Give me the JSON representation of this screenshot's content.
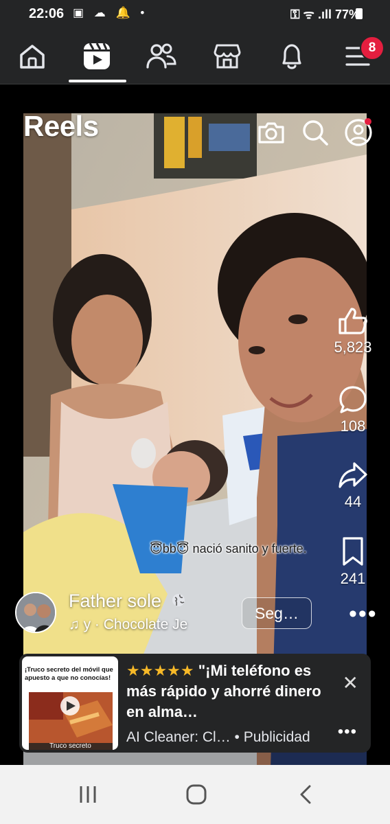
{
  "status_bar": {
    "time": "22:06",
    "left_icons": "▣ ☁ 🔔 •",
    "right_text": "⚿ ᯤ .ıll 77%"
  },
  "nav": {
    "items": [
      {
        "name": "home",
        "icon": "home-icon"
      },
      {
        "name": "reels",
        "icon": "reels-icon",
        "active": true
      },
      {
        "name": "friends",
        "icon": "friends-icon"
      },
      {
        "name": "marketplace",
        "icon": "marketplace-icon"
      },
      {
        "name": "notifications",
        "icon": "bell-icon"
      },
      {
        "name": "menu",
        "icon": "menu-icon"
      }
    ],
    "menu_badge": "8"
  },
  "reels": {
    "title": "Reels",
    "likes": "5,823",
    "comments": "108",
    "shares": "44",
    "saves": "241",
    "caption": "😇bb😇 nació sanito y fuerte.",
    "author": "Father sole",
    "music": "♫ y · Chocolate    Je",
    "follow_label": "Seg…"
  },
  "ad": {
    "thumb_text": "¡Truco secreto del móvil que apuesto a que no conocías!",
    "thumb_caption": "Truco secreto",
    "headline": "★★★★★ \"¡Mi teléfono es más rápido y ahorré dinero en alma…",
    "sponsor": "AI Cleaner: Cl…  • Publicidad",
    "stars_color": "#f7b928"
  },
  "colors": {
    "bar_bg": "#242526",
    "badge": "#e41e3f",
    "accent_dot": "#e41e3f"
  }
}
